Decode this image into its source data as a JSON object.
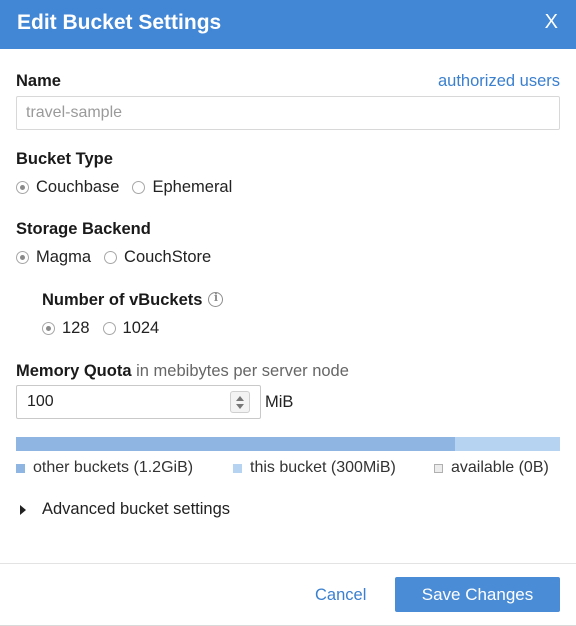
{
  "dialog": {
    "title": "Edit Bucket Settings",
    "close_label": "X"
  },
  "name_section": {
    "label": "Name",
    "link": "authorized users",
    "value": "travel-sample"
  },
  "bucket_type": {
    "label": "Bucket Type",
    "options": [
      {
        "label": "Couchbase",
        "checked": true
      },
      {
        "label": "Ephemeral",
        "checked": false
      }
    ]
  },
  "storage_backend": {
    "label": "Storage Backend",
    "options": [
      {
        "label": "Magma",
        "checked": true
      },
      {
        "label": "CouchStore",
        "checked": false
      }
    ]
  },
  "vbuckets": {
    "label": "Number of vBuckets",
    "icon": "info-icon",
    "options": [
      {
        "label": "128",
        "checked": true
      },
      {
        "label": "1024",
        "checked": false
      }
    ]
  },
  "memory_quota": {
    "label": "Memory Quota",
    "hint": "in mebibytes per server node",
    "value": "100",
    "unit": "MiB"
  },
  "usage_bar": {
    "other_fraction": 0.807,
    "colors": {
      "other": "#8fb6e2",
      "this": "#b7d3f2",
      "available": "#ececec"
    },
    "legend": [
      {
        "label": "other buckets (1.2GiB)"
      },
      {
        "label": "this bucket (300MiB)"
      },
      {
        "label": "available (0B)"
      }
    ]
  },
  "advanced": {
    "label": "Advanced bucket settings",
    "icon": "caret-right-icon"
  },
  "footer": {
    "cancel_label": "Cancel",
    "save_label": "Save Changes"
  }
}
